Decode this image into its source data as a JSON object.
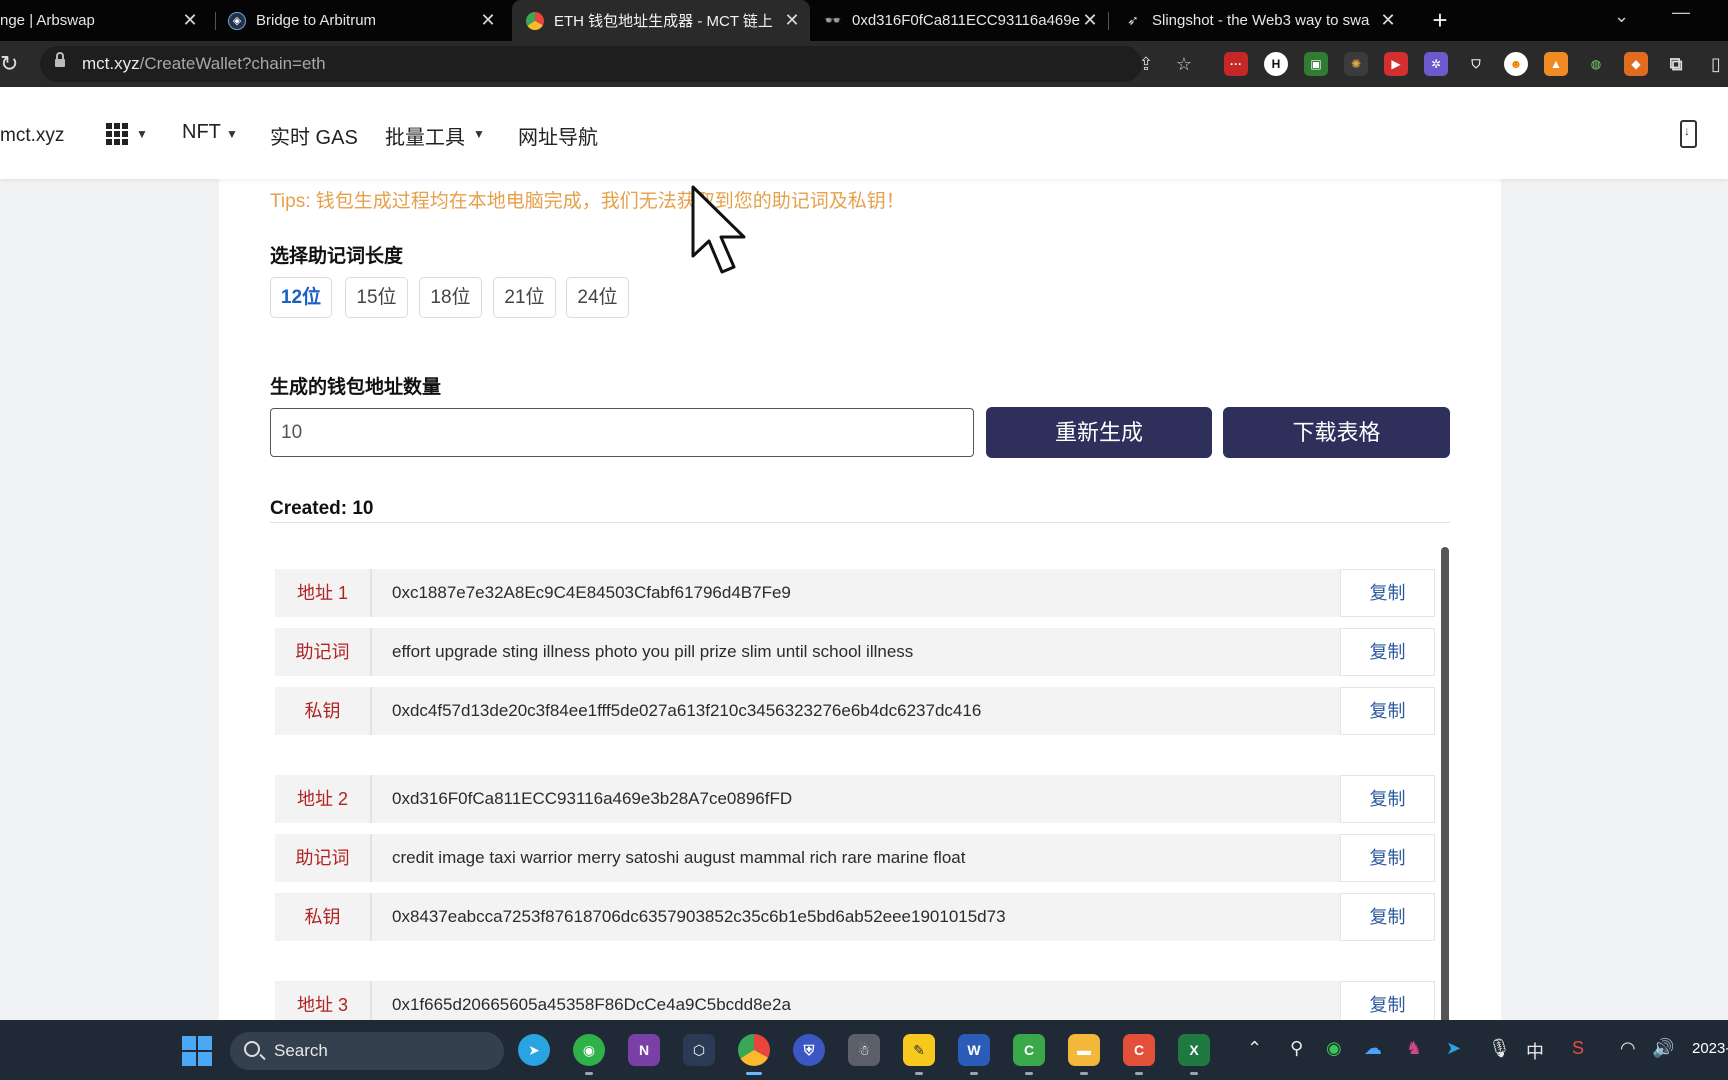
{
  "browser": {
    "tabs": [
      {
        "title": "nge | Arbswap",
        "active": false
      },
      {
        "title": "Bridge to Arbitrum",
        "active": false
      },
      {
        "title": "ETH 钱包地址生成器 - MCT 链上",
        "active": true
      },
      {
        "title": "0xd316F0fCa811ECC93116a469e",
        "active": false
      },
      {
        "title": "Slingshot - the Web3 way to swa",
        "active": false
      }
    ],
    "url_host": "mct.xyz",
    "url_path": "/CreateWallet?chain=eth"
  },
  "site": {
    "brand": "mct.xyz",
    "nav": {
      "nft": "NFT",
      "gas": "实时 GAS",
      "batch": "批量工具",
      "links": "网址导航"
    }
  },
  "page": {
    "tips": "Tips: 钱包生成过程均在本地电脑完成，我们无法获取到您的助记词及私钥！",
    "length_label": "选择助记词长度",
    "length_options": [
      "12位",
      "15位",
      "18位",
      "21位",
      "24位"
    ],
    "selected_length": "12位",
    "count_label": "生成的钱包地址数量",
    "count_value": "10",
    "regenerate_label": "重新生成",
    "download_label": "下载表格",
    "created_text": "Created: 10",
    "copy_label": "复制",
    "wallets": [
      {
        "address_label": "地址 1",
        "address": "0xc1887e7e32A8Ec9C4E84503Cfabf61796d4B7Fe9",
        "mnemonic_label": "助记词",
        "mnemonic": "effort upgrade sting illness photo you pill prize slim until school illness",
        "private_key_label": "私钥",
        "private_key": "0xdc4f57d13de20c3f84ee1fff5de027a613f210c3456323276e6b4dc6237dc416"
      },
      {
        "address_label": "地址 2",
        "address": "0xd316F0fCa811ECC93116a469e3b28A7ce0896fFD",
        "mnemonic_label": "助记词",
        "mnemonic": "credit image taxi warrior merry satoshi august mammal rich rare marine float",
        "private_key_label": "私钥",
        "private_key": "0x8437eabcca7253f87618706dc6357903852c35c6b1e5bd6ab52eee1901015d73"
      },
      {
        "address_label": "地址 3",
        "address": "0x1f665d20665605a45358F86DcCe4a9C5bcdd8e2a"
      }
    ]
  },
  "taskbar": {
    "search_label": "Search",
    "ime": "中",
    "clock": "2023-"
  },
  "colors": {
    "accent_button": "#2e2f5b",
    "tips": "#e7a04a",
    "row_label": "#b02424",
    "copy_link": "#2d5a9f",
    "selected_option": "#1b5fc4"
  }
}
